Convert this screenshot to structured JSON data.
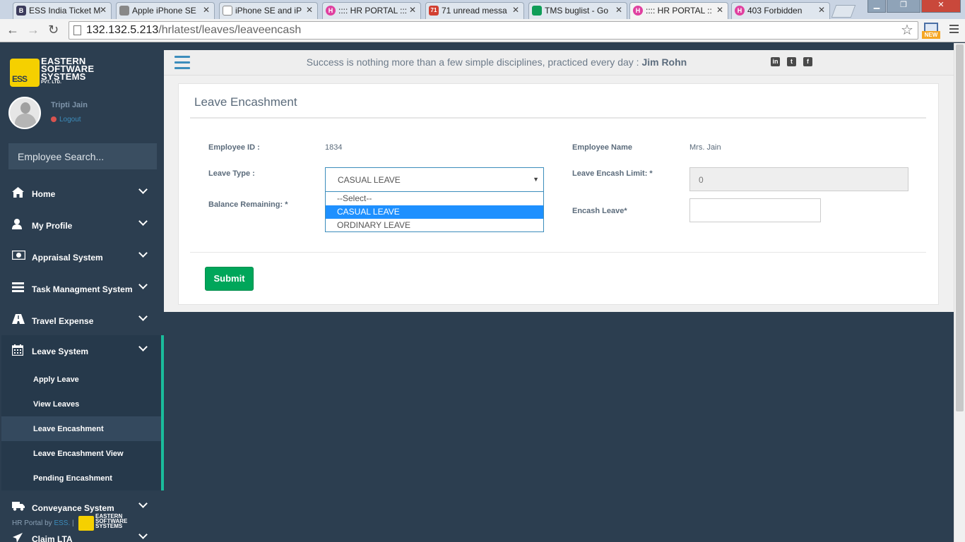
{
  "browser": {
    "tabs": [
      {
        "title": "ESS India Ticket M",
        "favicon": "B",
        "favicon_color": "#3b3b5c"
      },
      {
        "title": "Apple iPhone SE",
        "favicon": "",
        "favicon_color": "#888888"
      },
      {
        "title": "iPhone SE and iP",
        "favicon": "",
        "favicon_color": "#aaaaaa"
      },
      {
        "title": ":::: HR PORTAL :::",
        "favicon": "H",
        "favicon_color": "#e040a0"
      },
      {
        "title": "71 unread messa",
        "favicon": "71",
        "favicon_color": "#d23f31"
      },
      {
        "title": "TMS buglist - Go",
        "favicon": "",
        "favicon_color": "#0f9d58"
      },
      {
        "title": ":::: HR PORTAL ::",
        "favicon": "H",
        "favicon_color": "#e040a0"
      },
      {
        "title": "403 Forbidden",
        "favicon": "H",
        "favicon_color": "#e040a0"
      }
    ],
    "url_host": "132.132.5.213",
    "url_path": "/hrlatest/leaves/leaveencash",
    "ext_badge": "NEW"
  },
  "sidebar": {
    "logo_lines": [
      "EASTERN",
      "SOFTWARE",
      "SYSTEMS"
    ],
    "logo_sub": "PVT. LTD.",
    "logo_mark": "ESS",
    "user_name": "Tripti Jain",
    "logout_label": "Logout",
    "search_placeholder": "Employee Search...",
    "items": [
      {
        "label": "Home",
        "icon": "home-icon"
      },
      {
        "label": "My Profile",
        "icon": "user-icon"
      },
      {
        "label": "Appraisal System",
        "icon": "money-icon"
      },
      {
        "label": "Task Managment System",
        "icon": "list-icon"
      },
      {
        "label": "Travel Expense",
        "icon": "road-icon"
      },
      {
        "label": "Leave System",
        "icon": "calendar-icon"
      },
      {
        "label": "Conveyance System",
        "icon": "truck-icon"
      },
      {
        "label": "Claim LTA",
        "icon": "plane-icon"
      }
    ],
    "sub_items": [
      {
        "label": "Apply Leave"
      },
      {
        "label": "View Leaves"
      },
      {
        "label": "Leave Encashment"
      },
      {
        "label": "Leave Encashment View"
      },
      {
        "label": "Pending Encashment"
      }
    ],
    "footer_prefix": "HR Portal by",
    "footer_brand": "ESS.",
    "footer_sep": "|"
  },
  "topbar": {
    "quote": "Success is nothing more than a few simple disciplines, practiced every day :",
    "author": "Jim Rohn",
    "social": [
      "in",
      "t",
      "f"
    ]
  },
  "form": {
    "title": "Leave Encashment",
    "employee_id_label": "Employee ID :",
    "employee_id": "1834",
    "employee_name_label": "Employee Name",
    "employee_name": "Mrs. Jain",
    "leave_type_label": "Leave Type :",
    "leave_type_value": "CASUAL LEAVE",
    "leave_type_options": [
      "--Select--",
      "CASUAL LEAVE",
      "ORDINARY LEAVE"
    ],
    "balance_label": "Balance Remaining: *",
    "encash_limit_label": "Leave Encash Limit: *",
    "encash_limit_value": "0",
    "encash_leave_label": "Encash Leave*",
    "encash_leave_value": "",
    "submit_label": "Submit"
  }
}
